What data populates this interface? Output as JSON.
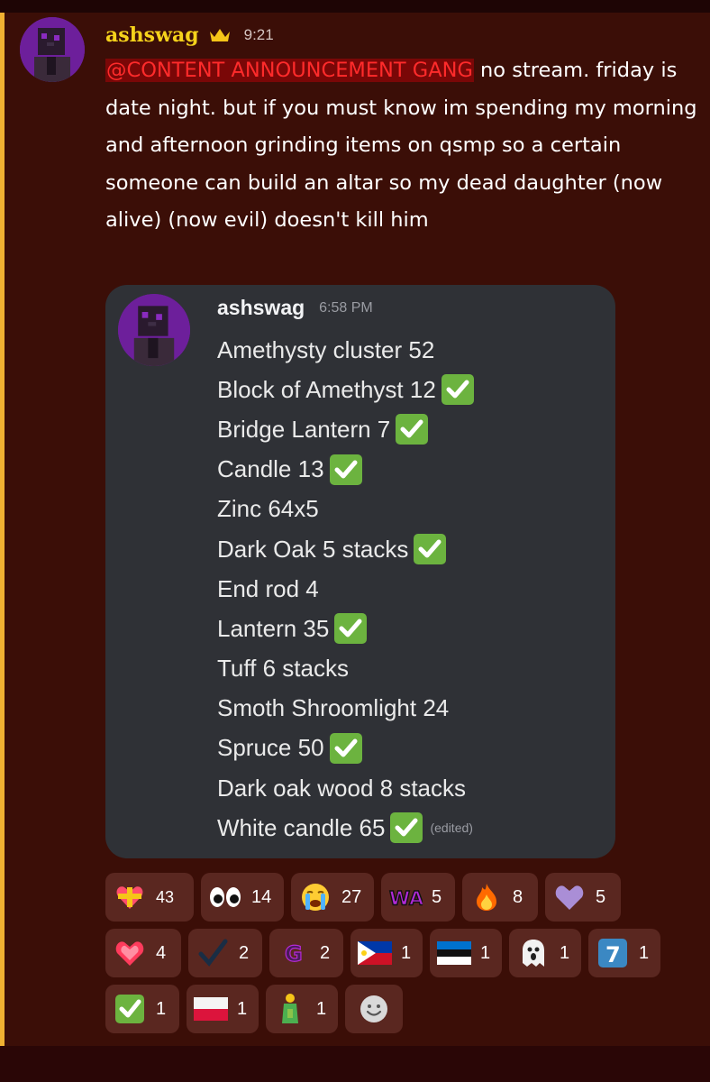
{
  "message": {
    "author": "ashswag",
    "time": "9:21",
    "mention": "@CONTENT ANNOUNCEMENT GANG",
    "text": " no stream. friday is date night. but if you must know im spending my morning and afternoon grinding items on qsmp so a certain someone can build an altar so my dead daughter (now alive) (now evil) doesn't kill him"
  },
  "embed": {
    "author": "ashswag",
    "time": "6:58 PM",
    "items": [
      {
        "text": "Amethysty cluster 52",
        "checked": false
      },
      {
        "text": "Block of Amethyst 12",
        "checked": true
      },
      {
        "text": "Bridge Lantern 7",
        "checked": true
      },
      {
        "text": "Candle 13",
        "checked": true
      },
      {
        "text": "Zinc 64x5",
        "checked": false
      },
      {
        "text": "Dark Oak 5 stacks",
        "checked": true
      },
      {
        "text": "End rod 4",
        "checked": false
      },
      {
        "text": "Lantern 35",
        "checked": true
      },
      {
        "text": "Tuff 6 stacks",
        "checked": false
      },
      {
        "text": "Smoth Shroomlight 24",
        "checked": false
      },
      {
        "text": "Spruce 50",
        "checked": true
      },
      {
        "text": "Dark oak wood 8 stacks",
        "checked": false
      },
      {
        "text": "White candle 65",
        "checked": true
      }
    ],
    "edited": "(edited)"
  },
  "reactions": [
    {
      "icon": "heart-ribbon-icon",
      "count": "43"
    },
    {
      "icon": "eyes-icon",
      "count": "14"
    },
    {
      "icon": "crying-face-icon",
      "count": "27"
    },
    {
      "icon": "wa-emote-icon",
      "count": "5"
    },
    {
      "icon": "fire-icon",
      "count": "8"
    },
    {
      "icon": "purple-heart-icon",
      "count": "5"
    },
    {
      "icon": "heartpulse-icon",
      "count": "4"
    },
    {
      "icon": "checkmark-icon",
      "count": "2"
    },
    {
      "icon": "g-emote-icon",
      "count": "2"
    },
    {
      "icon": "philippines-flag-icon",
      "count": "1"
    },
    {
      "icon": "estonia-flag-icon",
      "count": "1"
    },
    {
      "icon": "ghost-icon",
      "count": "1"
    },
    {
      "icon": "keycap-seven-icon",
      "count": "1"
    },
    {
      "icon": "check-box-icon",
      "count": "1"
    },
    {
      "icon": "poland-flag-icon",
      "count": "1"
    },
    {
      "icon": "person-bottle-icon",
      "count": "1"
    },
    {
      "icon": "add-reaction-icon",
      "count": ""
    }
  ]
}
